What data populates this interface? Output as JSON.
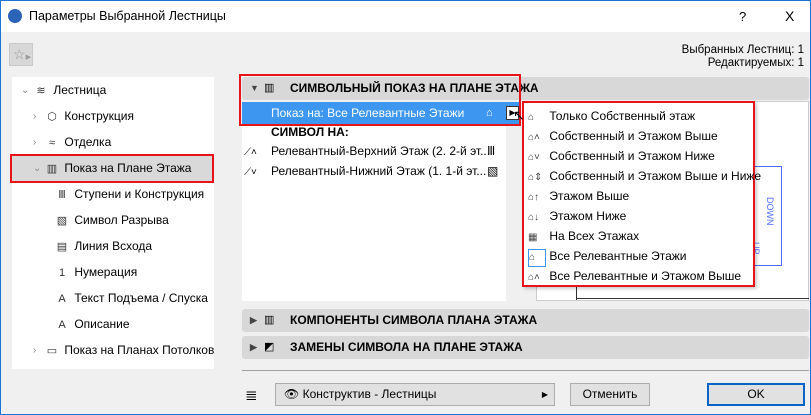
{
  "window": {
    "title": "Параметры Выбранной Лестницы",
    "help": "?",
    "close": "X"
  },
  "info": {
    "selected": "Выбранных Лестниц: 1",
    "editable": "Редактируемых: 1"
  },
  "tree": [
    {
      "label": "Лестница",
      "icon": "stair-icon"
    },
    {
      "label": "Конструкция",
      "icon": "structure-icon"
    },
    {
      "label": "Отделка",
      "icon": "finish-icon"
    },
    {
      "label": "Показ на Плане Этажа",
      "icon": "floor-plan-icon"
    },
    {
      "label": "Ступени и Конструкция",
      "icon": "treads-icon"
    },
    {
      "label": "Символ Разрыва",
      "icon": "break-mark-icon"
    },
    {
      "label": "Линия Всхода",
      "icon": "walking-line-icon"
    },
    {
      "label": "Нумерация",
      "icon": "numbering-icon"
    },
    {
      "label": "Текст Подъема / Спуска",
      "icon": "text-icon"
    },
    {
      "label": "Описание",
      "icon": "text-icon"
    },
    {
      "label": "Показ на Планах Потолков",
      "icon": "ceiling-plan-icon"
    }
  ],
  "section1": {
    "title": "СИМВОЛЬНЫЙ ПОКАЗ НА ПЛАНЕ ЭТАЖА",
    "show_on": "Показ на: Все Релевантные Этажи",
    "symbol_on": "СИМВОЛ НА:",
    "rows": [
      "Релевантный-Верхний Этаж (2. 2-й эт...",
      "Релевантный-Нижний Этаж (1. 1-й эт..."
    ]
  },
  "menu": [
    "Только Собственный этаж",
    "Собственный и Этажом Выше",
    "Собственный и Этажом Ниже",
    "Собственный и Этажом Выше и Ниже",
    "Этажом Выше",
    "Этажом Ниже",
    "На Всех Этажах",
    "Все Релевантные Этажи",
    "Все Релевантные и Этажом Выше"
  ],
  "menu_selected": 7,
  "preview": {
    "down": "DOWN",
    "up": "UP"
  },
  "section2": {
    "title": "КОМПОНЕНТЫ СИМВОЛА ПЛАНА ЭТАЖА"
  },
  "section3": {
    "title": "ЗАМЕНЫ СИМВОЛА НА ПЛАНЕ ЭТАЖА"
  },
  "footer": {
    "layer": "Конструктив - Лестницы",
    "cancel": "Отменить",
    "ok": "OK"
  }
}
